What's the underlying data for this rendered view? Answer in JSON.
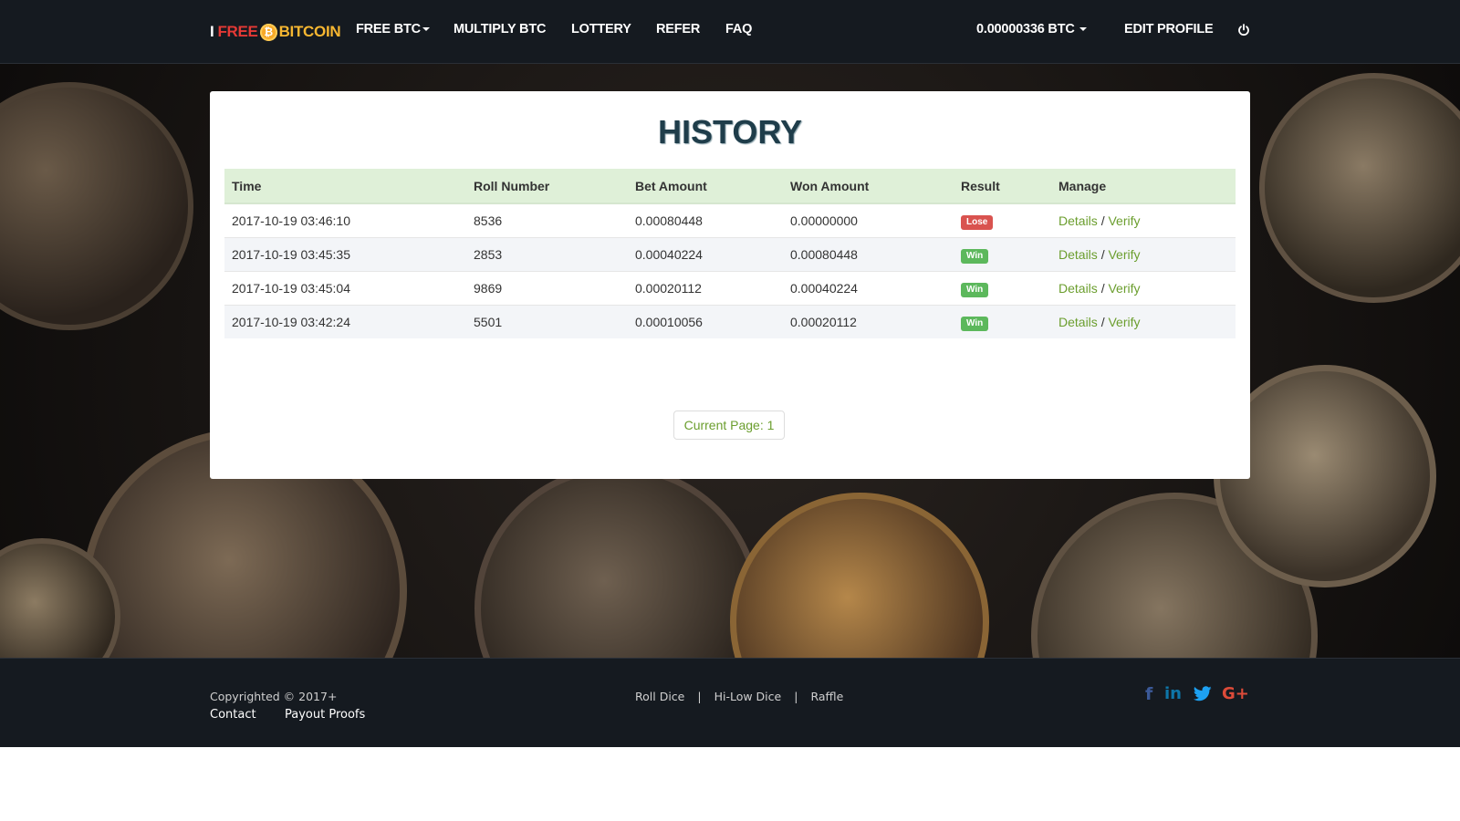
{
  "nav": {
    "brand": {
      "prefix": "I",
      "free": "FREE",
      "coin_symbol": "₿",
      "bitcoin": "BITCOIN"
    },
    "items": [
      {
        "label": "FREE BTC",
        "dropdown": true
      },
      {
        "label": "MULTIPLY BTC"
      },
      {
        "label": "LOTTERY"
      },
      {
        "label": "REFER"
      },
      {
        "label": "FAQ"
      }
    ],
    "balance": "0.00000336 BTC",
    "edit_profile": "EDIT PROFILE",
    "logout_icon": "power-icon"
  },
  "history": {
    "title": "HISTORY",
    "columns": [
      "Time",
      "Roll Number",
      "Bet Amount",
      "Won Amount",
      "Result",
      "Manage"
    ],
    "rows": [
      {
        "time": "2017-10-19 03:46:10",
        "roll": "8536",
        "bet": "0.00080448",
        "won": "0.00000000",
        "result": "Lose",
        "details": "Details",
        "sep": "/",
        "verify": "Verify"
      },
      {
        "time": "2017-10-19 03:45:35",
        "roll": "2853",
        "bet": "0.00040224",
        "won": "0.00080448",
        "result": "Win",
        "details": "Details",
        "sep": "/",
        "verify": "Verify"
      },
      {
        "time": "2017-10-19 03:45:04",
        "roll": "9869",
        "bet": "0.00020112",
        "won": "0.00040224",
        "result": "Win",
        "details": "Details",
        "sep": "/",
        "verify": "Verify"
      },
      {
        "time": "2017-10-19 03:42:24",
        "roll": "5501",
        "bet": "0.00010056",
        "won": "0.00020112",
        "result": "Win",
        "details": "Details",
        "sep": "/",
        "verify": "Verify"
      }
    ],
    "pager": "Current Page: 1"
  },
  "footer": {
    "copyright": "Copyrighted  © 2017+",
    "contact": "Contact",
    "payout_proofs": "Payout Proofs",
    "links": [
      "Roll Dice",
      "Hi-Low Dice",
      "Raffle"
    ],
    "divider": "|",
    "social": [
      {
        "icon": "facebook-icon",
        "glyph": "f",
        "color": "#3b5998"
      },
      {
        "icon": "linkedin-icon",
        "glyph": "in",
        "color": "#0e76a8"
      },
      {
        "icon": "twitter-icon",
        "glyph": "🐦",
        "color": "#1da1f2"
      },
      {
        "icon": "google-plus-icon",
        "glyph": "G+",
        "color": "#dd4b39"
      }
    ]
  },
  "colors": {
    "navbar_bg": "#151a20",
    "accent_green": "#6b9e2e",
    "header_row_bg": "#dff0d8",
    "lose_badge": "#d9534f",
    "win_badge": "#5cb85c",
    "brand_red": "#e53935",
    "brand_gold": "#f7b731"
  }
}
